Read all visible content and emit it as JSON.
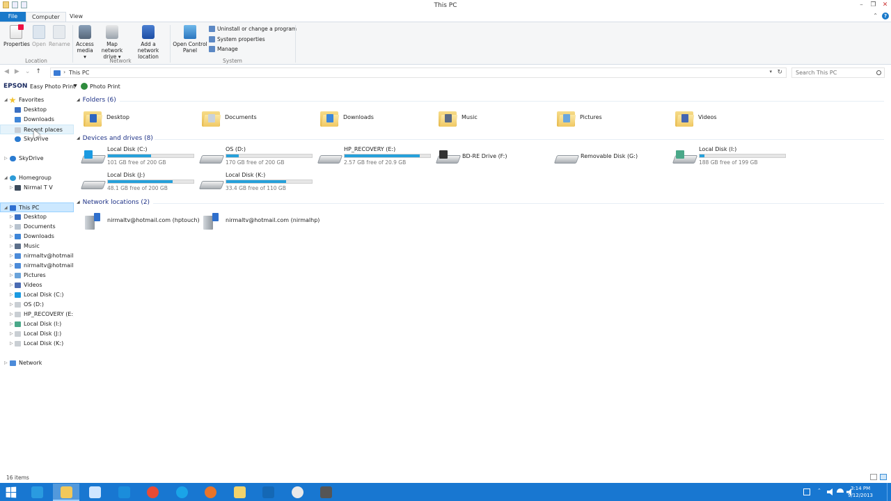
{
  "window": {
    "title": "This PC",
    "controls": {
      "minimize": "–",
      "maximize": "❐",
      "close": "✕"
    }
  },
  "ribbon_tabs": {
    "file": "File",
    "computer": "Computer",
    "view": "View"
  },
  "ribbon": {
    "properties": "Properties",
    "open": "Open",
    "rename": "Rename",
    "access_media_1": "Access",
    "access_media_2": "media ▾",
    "map_drive_1": "Map network",
    "map_drive_2": "drive ▾",
    "add_location_1": "Add a network",
    "add_location_2": "location",
    "open_cp_1": "Open Control",
    "open_cp_2": "Panel",
    "uninstall": "Uninstall or change a program",
    "system_properties": "System properties",
    "manage": "Manage",
    "group_location": "Location",
    "group_network": "Network",
    "group_system": "System"
  },
  "address": {
    "path": "This PC",
    "search_placeholder": "Search This PC"
  },
  "toolbar": {
    "epson": "EPSON",
    "easy_photo_print": "Easy Photo Print",
    "photo_print": "Photo Print"
  },
  "nav": {
    "favorites": "Favorites",
    "fav_desktop": "Desktop",
    "fav_downloads": "Downloads",
    "fav_recent": "Recent places",
    "skydrive_sub": "SkyDrive",
    "skydrive": "SkyDrive",
    "homegroup": "Homegroup",
    "user": "Nirmal T V",
    "thispc": "This PC",
    "pc_desktop": "Desktop",
    "pc_documents": "Documents",
    "pc_downloads": "Downloads",
    "pc_music": "Music",
    "pc_net1": "nirmaltv@hotmail.c",
    "pc_net2": "nirmaltv@hotmail.c",
    "pc_pictures": "Pictures",
    "pc_videos": "Videos",
    "pc_c": "Local Disk (C:)",
    "pc_d": "OS (D:)",
    "pc_e": "HP_RECOVERY (E:)",
    "pc_i": "Local Disk (I:)",
    "pc_j": "Local Disk (J:)",
    "pc_k": "Local Disk (K:)",
    "network": "Network"
  },
  "groups": {
    "folders": "Folders (6)",
    "devices": "Devices and drives (8)",
    "network": "Network locations (2)"
  },
  "folders": [
    {
      "name": "Desktop",
      "badge_color": "#2f66c0"
    },
    {
      "name": "Documents",
      "badge_color": "#c9d2dc"
    },
    {
      "name": "Downloads",
      "badge_color": "#3a86db"
    },
    {
      "name": "Music",
      "badge_color": "#5a6a84"
    },
    {
      "name": "Pictures",
      "badge_color": "#6aa6dd"
    },
    {
      "name": "Videos",
      "badge_color": "#4566b0"
    }
  ],
  "drives": [
    {
      "name": "Local Disk (C:)",
      "free": "101 GB free of 200 GB",
      "used_fraction": 0.5,
      "logo_color": "#1b9ae1"
    },
    {
      "name": "OS (D:)",
      "free": "170 GB free of 200 GB",
      "used_fraction": 0.15,
      "logo_color": ""
    },
    {
      "name": "HP_RECOVERY (E:)",
      "free": "2.57 GB free of 20.9 GB",
      "used_fraction": 0.88,
      "logo_color": ""
    },
    {
      "name": "BD-RE Drive (F:)",
      "free": "",
      "used_fraction": null,
      "logo_color": "#333"
    },
    {
      "name": "Removable Disk (G:)",
      "free": "",
      "used_fraction": null,
      "logo_color": ""
    },
    {
      "name": "Local Disk (I:)",
      "free": "188 GB free of 199 GB",
      "used_fraction": 0.06,
      "logo_color": "#4aa889"
    },
    {
      "name": "Local Disk (J:)",
      "free": "48.1 GB free of 200 GB",
      "used_fraction": 0.76,
      "logo_color": ""
    },
    {
      "name": "Local Disk (K:)",
      "free": "33.4 GB free of 110 GB",
      "used_fraction": 0.7,
      "logo_color": ""
    }
  ],
  "network_locations": [
    {
      "name": "nirmaltv@hotmail.com (hptouch)"
    },
    {
      "name": "nirmaltv@hotmail.com (nirmalhp)"
    }
  ],
  "status": {
    "items": "16 items"
  },
  "taskbar": {
    "apps": [
      "start-ie",
      "file-explorer",
      "sketch",
      "twitter",
      "chrome",
      "skype",
      "firefox",
      "folder",
      "outlook",
      "talk",
      "tool"
    ],
    "time": "3:14 PM",
    "date": "9/12/2013"
  },
  "colors": {
    "accent": "#1979ca",
    "taskbar": "#1877d1",
    "bar_fill": "#26a0da"
  }
}
